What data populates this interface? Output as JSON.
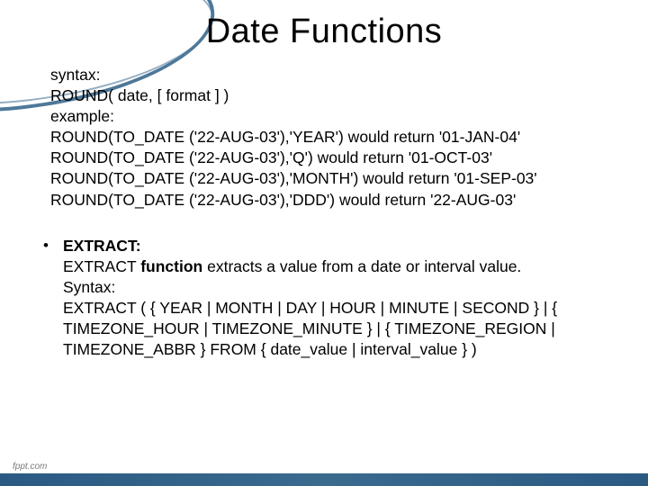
{
  "title": "Date Functions",
  "round": {
    "syntax_label": "syntax:",
    "syntax_text": " ROUND( date, [ format ] )",
    "example_label": "example:",
    "ex1": "ROUND(TO_DATE ('22-AUG-03'),'YEAR') would return '01-JAN-04'",
    "ex2": "ROUND(TO_DATE ('22-AUG-03'),'Q') would return '01-OCT-03'",
    "ex3": "ROUND(TO_DATE ('22-AUG-03'),'MONTH') would return '01-SEP-03'",
    "ex4": "ROUND(TO_DATE ('22-AUG-03'),'DDD') would return '22-AUG-03'"
  },
  "extract": {
    "heading": "EXTRACT:",
    "desc_pre": "EXTRACT ",
    "desc_bold": "function",
    "desc_post": " extracts a value from a date or interval value.",
    "syntax_label": " Syntax:",
    "syntax_text": "EXTRACT ( { YEAR | MONTH | DAY | HOUR | MINUTE | SECOND } | { TIMEZONE_HOUR | TIMEZONE_MINUTE } | { TIMEZONE_REGION | TIMEZONE_ABBR } FROM { date_value | interval_value } )"
  },
  "footer": "fppt.com"
}
